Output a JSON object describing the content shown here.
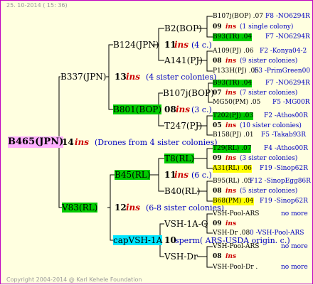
{
  "header": {
    "timestamp": "25. 10-2014 ( 15: 36)"
  },
  "footer": {
    "copyright": "Copyright 2004-2014 @ Karl Kehele Foundation"
  },
  "root": {
    "name": "B465(JPN)",
    "year": "14",
    "ins": "ins",
    "note": "(Drones from 4 sister colonies)"
  },
  "sire": {
    "name": "B337(JPN)",
    "year": "13",
    "ins": "ins",
    "note": "(4 sister colonies)",
    "sire": {
      "name": "B124(JPN)",
      "year": "11",
      "ins": "ins",
      "note": "(4 c.)",
      "sire": {
        "name": "B2(BOP)"
      },
      "dam": {
        "name": "A141(PJ)"
      }
    },
    "dam": {
      "name": "B801(BOP)",
      "year": "08",
      "ins": "ins",
      "note": "(3 c.)",
      "sire": {
        "name": "B107j(BOP)"
      },
      "dam": {
        "name": "T247(PJ)"
      }
    }
  },
  "dam": {
    "name": "V83(RL)",
    "year": "12",
    "ins": "ins",
    "note": "(6-8 sister colonies)",
    "sire": {
      "name": "B45(RL)",
      "year": "11",
      "ins": "ins",
      "note": "(6 c.)",
      "sire": {
        "name": "T8(RL)"
      },
      "dam": {
        "name": "B40(RL)"
      }
    },
    "dam": {
      "name": "capVSH-1A",
      "year": "10",
      "ins": "sperm( ARS-USDA origin. c.)",
      "sire": {
        "name": "VSH-1A-Q"
      },
      "dam": {
        "name": "VSH-Dr"
      }
    }
  },
  "gen4": [
    {
      "n1": "B107j(BOP) .07",
      "r1": "F8 -NO6294R",
      "y": "09",
      "i": "ins",
      "c": "(1 single colony)",
      "n2": "B93(TR) .04",
      "r2": "F7 -NO6294R"
    },
    {
      "n1": "A109(PJ) .06",
      "r1": "F2 -Konya04-2",
      "y": "08",
      "i": "ins",
      "c": "(9 sister colonies)",
      "n2": "P133H(PJ) .05",
      "r2": "F3 -PrimGreen00"
    },
    {
      "n1": "B93(TR) .04",
      "r1": "F7 -NO6294R",
      "y": "07",
      "i": "ins",
      "c": "(7 sister colonies)",
      "n2": "MG50(PM) .05",
      "r2": "F5 -MG00R"
    },
    {
      "n1": "T202(PJ) .03",
      "r1": "F2 -Athos00R",
      "y": "05",
      "i": "ins",
      "c": "(10 sister colonies)",
      "n2": "B158(PJ) .01",
      "r2": "F5 -Takab93R"
    },
    {
      "n1": "T29(RL) .07",
      "r1": "F4 -Athos00R",
      "y": "09",
      "i": "ins",
      "c": "(3 sister colonies)",
      "n2": "A31(RL) .06",
      "r2": "F19 -Sinop62R"
    },
    {
      "n1": "B95(RL) .05",
      "r1": "F12 -SinopEgg86R",
      "y": "08",
      "i": "ins",
      "c": "(5 sister colonies)",
      "n2": "B68(PM) .04",
      "r2": "F19 -Sinop62R"
    },
    {
      "n1": "VSH-Pool-ARS",
      "r1": "no more",
      "y": "09",
      "i": "ins",
      "c": "",
      "n2": "VSH-Dr .08",
      "r2": "0 -VSH-Pool-ARS"
    },
    {
      "n1": "VSH-Pool-ARS",
      "r1": "no more",
      "y": "08",
      "i": "ins",
      "c": "",
      "n2": "VSH-Pool-Dr .",
      "r2": "no more"
    }
  ],
  "colors": {
    "frame": "#c000c0",
    "background": "#ffffe0",
    "green": "#00cc00",
    "yellow": "#ffff00",
    "cyan": "#00e5ff",
    "pink": "#ffb0ff",
    "ins": "#cc0000",
    "ref": "#0000c0"
  }
}
